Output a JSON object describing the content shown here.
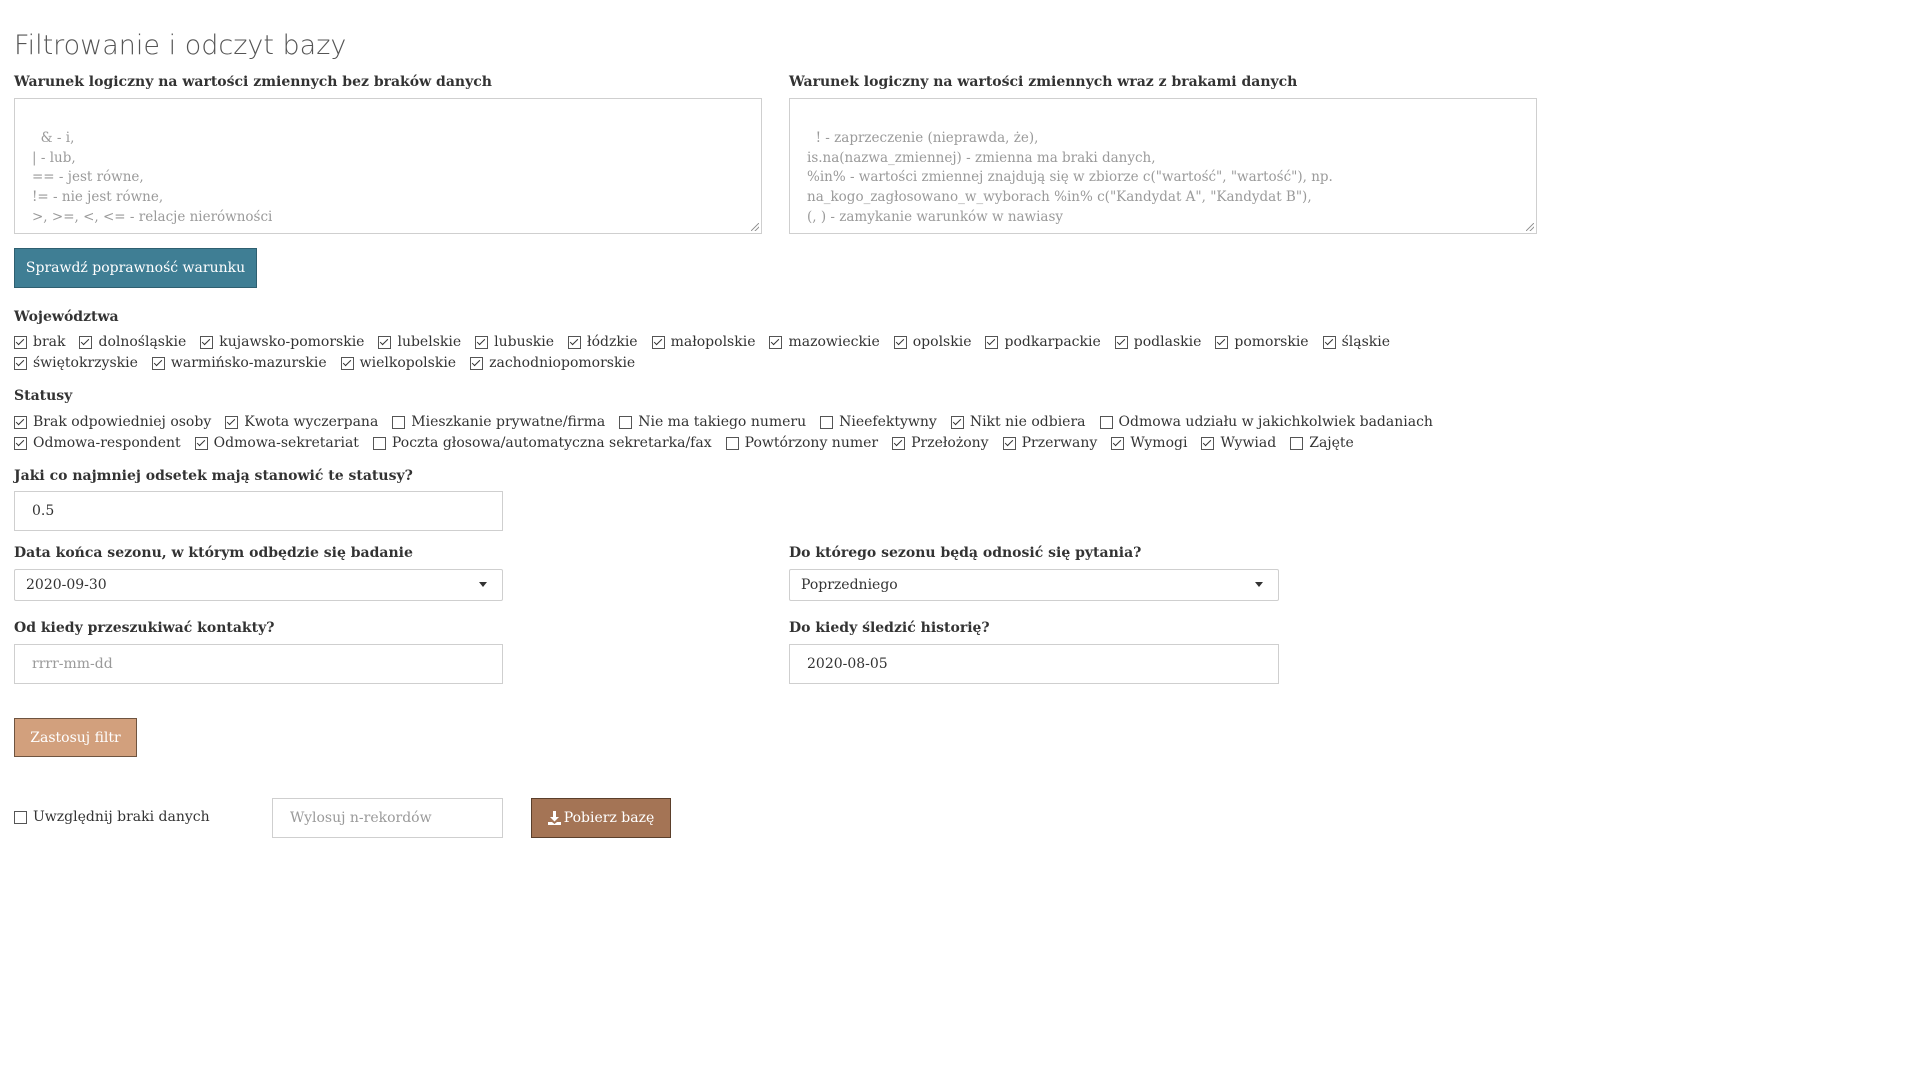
{
  "page": {
    "title": "Filtrowanie i odczyt bazy"
  },
  "condition_no_missing": {
    "label": "Warunek logiczny na wartości zmiennych bez braków danych",
    "placeholder": "& - i,\n| - lub,\n== - jest równe,\n!= - nie jest równe,\n>, >=, <, <= - relacje nierówności",
    "value": ""
  },
  "condition_with_missing": {
    "label": "Warunek logiczny na wartości zmiennych wraz z brakami danych",
    "placeholder": "! - zaprzeczenie (nieprawda, że),\nis.na(nazwa_zmiennej) - zmienna ma braki danych,\n%in% - wartości zmiennej znajdują się w zbiorze c(\"wartość\", \"wartość\"), np.\nna_kogo_zagłosowano_w_wyborach %in% c(\"Kandydat A\", \"Kandydat B\"),\n(, ) - zamykanie warunków w nawiasy",
    "value": ""
  },
  "check_button": {
    "label": "Sprawdź poprawność warunku"
  },
  "voivodeships": {
    "label": "Województwa",
    "options": [
      {
        "label": "brak",
        "checked": true
      },
      {
        "label": "dolnośląskie",
        "checked": true
      },
      {
        "label": "kujawsko-pomorskie",
        "checked": true
      },
      {
        "label": "lubelskie",
        "checked": true
      },
      {
        "label": "lubuskie",
        "checked": true
      },
      {
        "label": "łódzkie",
        "checked": true
      },
      {
        "label": "małopolskie",
        "checked": true
      },
      {
        "label": "mazowieckie",
        "checked": true
      },
      {
        "label": "opolskie",
        "checked": true
      },
      {
        "label": "podkarpackie",
        "checked": true
      },
      {
        "label": "podlaskie",
        "checked": true
      },
      {
        "label": "pomorskie",
        "checked": true
      },
      {
        "label": "śląskie",
        "checked": true
      },
      {
        "label": "świętokrzyskie",
        "checked": true
      },
      {
        "label": "warmińsko-mazurskie",
        "checked": true
      },
      {
        "label": "wielkopolskie",
        "checked": true
      },
      {
        "label": "zachodniopomorskie",
        "checked": true
      }
    ]
  },
  "statuses": {
    "label": "Statusy",
    "options": [
      {
        "label": "Brak odpowiedniej osoby",
        "checked": true
      },
      {
        "label": "Kwota wyczerpana",
        "checked": true
      },
      {
        "label": "Mieszkanie prywatne/firma",
        "checked": false
      },
      {
        "label": "Nie ma takiego numeru",
        "checked": false
      },
      {
        "label": "Nieefektywny",
        "checked": false
      },
      {
        "label": "Nikt nie odbiera",
        "checked": true
      },
      {
        "label": "Odmowa udziału w jakichkolwiek badaniach",
        "checked": false
      },
      {
        "label": "Odmowa-respondent",
        "checked": true
      },
      {
        "label": "Odmowa-sekretariat",
        "checked": true
      },
      {
        "label": "Poczta głosowa/automatyczna sekretarka/fax",
        "checked": false
      },
      {
        "label": "Powtórzony numer",
        "checked": false
      },
      {
        "label": "Przełożony",
        "checked": true
      },
      {
        "label": "Przerwany",
        "checked": true
      },
      {
        "label": "Wymogi",
        "checked": true
      },
      {
        "label": "Wywiad",
        "checked": true
      },
      {
        "label": "Zajęte",
        "checked": false
      }
    ]
  },
  "fraction": {
    "label": "Jaki co najmniej odsetek mają stanowić te statusy?",
    "value": "0.5"
  },
  "season_end": {
    "label": "Data końca sezonu, w którym odbędzie się badanie",
    "value": "2020-09-30"
  },
  "season_ref": {
    "label": "Do którego sezonu będą odnosić się pytania?",
    "value": "Poprzedniego"
  },
  "contacts_from": {
    "label": "Od kiedy przeszukiwać kontakty?",
    "placeholder": "rrrr-mm-dd",
    "value": ""
  },
  "history_until": {
    "label": "Do kiedy śledzić historię?",
    "value": "2020-08-05"
  },
  "apply_button": {
    "label": "Zastosuj filtr"
  },
  "include_missing": {
    "label": "Uwzględnij braki danych",
    "checked": false
  },
  "sample_input": {
    "placeholder": "Wylosuj n-rekordów",
    "value": ""
  },
  "download_button": {
    "label": "Pobierz bazę",
    "icon": "download-icon"
  }
}
